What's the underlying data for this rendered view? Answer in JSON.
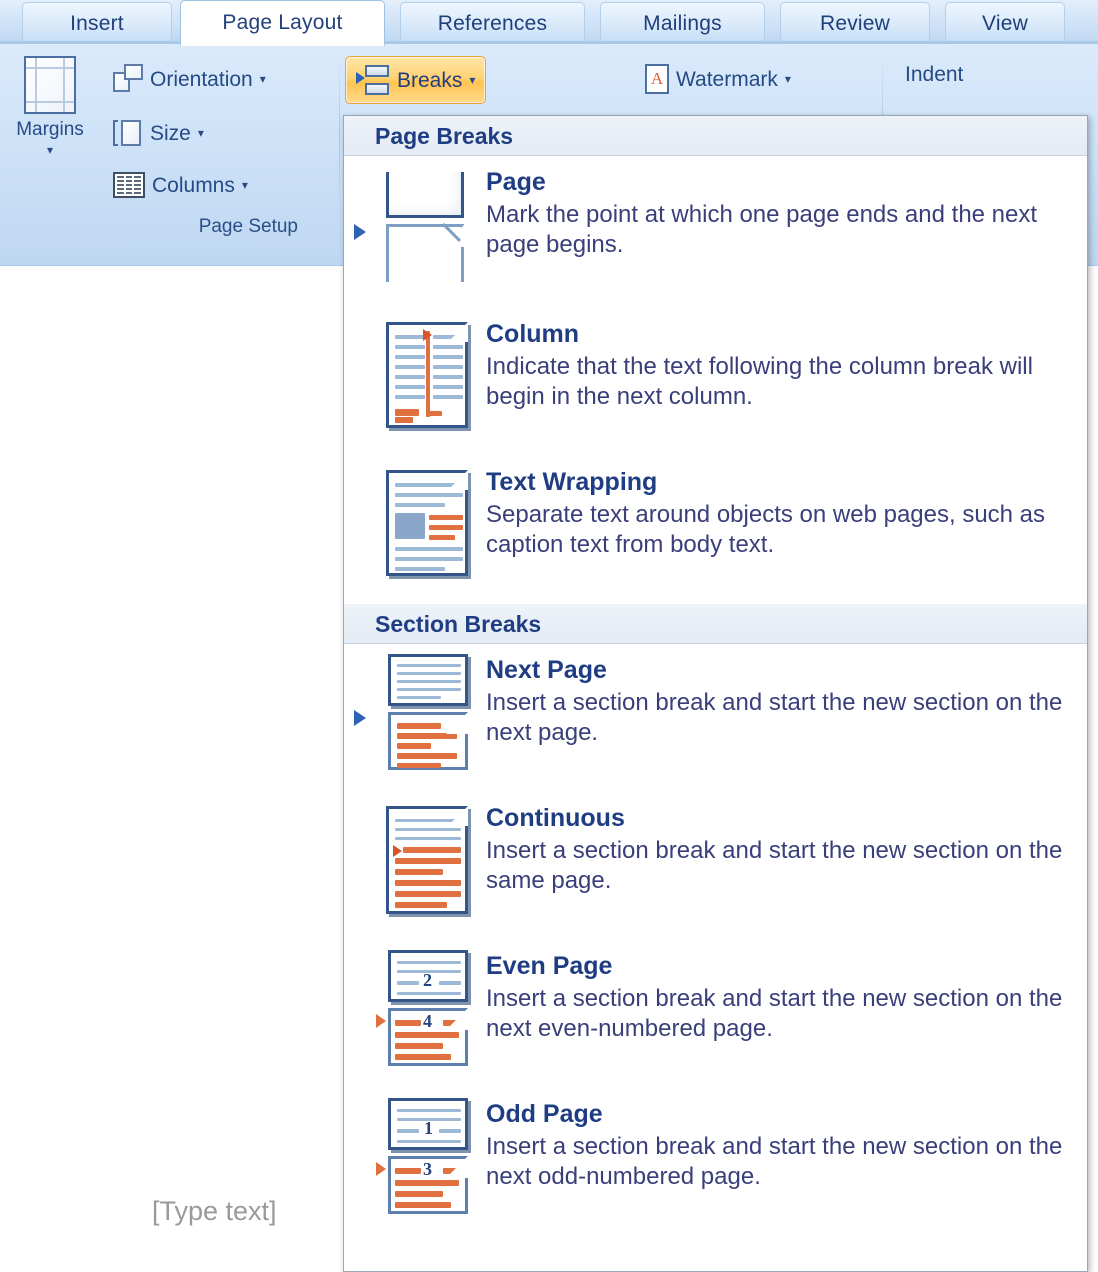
{
  "ribbon": {
    "tabs": [
      {
        "label": "Insert",
        "active": false
      },
      {
        "label": "Page Layout",
        "active": true
      },
      {
        "label": "References",
        "active": false
      },
      {
        "label": "Mailings",
        "active": false
      },
      {
        "label": "Review",
        "active": false
      },
      {
        "label": "View",
        "active": false
      }
    ],
    "groups": [
      {
        "name": "Page Setup",
        "label": "Page Setup"
      }
    ],
    "buttons": {
      "margins": "Margins",
      "orientation": "Orientation",
      "size": "Size",
      "columns": "Columns",
      "breaks": "Breaks",
      "watermark": "Watermark",
      "indent": "Indent"
    },
    "caret": "▾",
    "group_label_page_setup": "Page Setup"
  },
  "menu": {
    "sections": [
      {
        "header": "Page Breaks",
        "items": [
          {
            "title_pre": "",
            "title_key": "P",
            "title_post": "age",
            "title": "Page",
            "desc": "Mark the point at which one page ends and the next page begins.",
            "selected": true,
            "icon": "page-break-icon"
          },
          {
            "title_pre": "",
            "title_key": "C",
            "title_post": "olumn",
            "title": "Column",
            "desc": "Indicate that the text following the column break will begin in the next column.",
            "selected": false,
            "icon": "column-break-icon"
          },
          {
            "title_pre": "",
            "title_key": "T",
            "title_post": "ext Wrapping",
            "title": "Text Wrapping",
            "desc": "Separate text around objects on web pages, such as caption text from body text.",
            "selected": false,
            "icon": "text-wrapping-break-icon"
          }
        ]
      },
      {
        "header": "Section Breaks",
        "items": [
          {
            "title_pre": "",
            "title_key": "N",
            "title_post": "ext Page",
            "title": "Next Page",
            "desc": "Insert a section break and start the new section on the next page.",
            "selected": true,
            "icon": "next-page-break-icon"
          },
          {
            "title_pre": "C",
            "title_key": "o",
            "title_post": "ntinuous",
            "title": "Continuous",
            "desc": "Insert a section break and start the new section on the same page.",
            "selected": false,
            "icon": "continuous-break-icon"
          },
          {
            "title_pre": "",
            "title_key": "E",
            "title_post": "ven Page",
            "title": "Even Page",
            "desc": "Insert a section break and start the new section on the next even-numbered page.",
            "selected": false,
            "icon": "even-page-break-icon",
            "page_numbers": [
              "2",
              "4"
            ]
          },
          {
            "title_pre": "O",
            "title_key": "d",
            "title_post": "d Page",
            "title": "Odd Page",
            "desc": "Insert a section break and start the new section on the next odd-numbered page.",
            "selected": false,
            "icon": "odd-page-break-icon",
            "page_numbers": [
              "1",
              "3"
            ]
          }
        ]
      }
    ]
  },
  "document": {
    "placeholder": "[Type text]"
  },
  "colors": {
    "accent_blue": "#1f3d82",
    "highlight_orange": "#ffc451",
    "icon_orange": "#e0703f",
    "ribbon_blue": "#cfe3f8",
    "tab_active": "#ffffff"
  }
}
